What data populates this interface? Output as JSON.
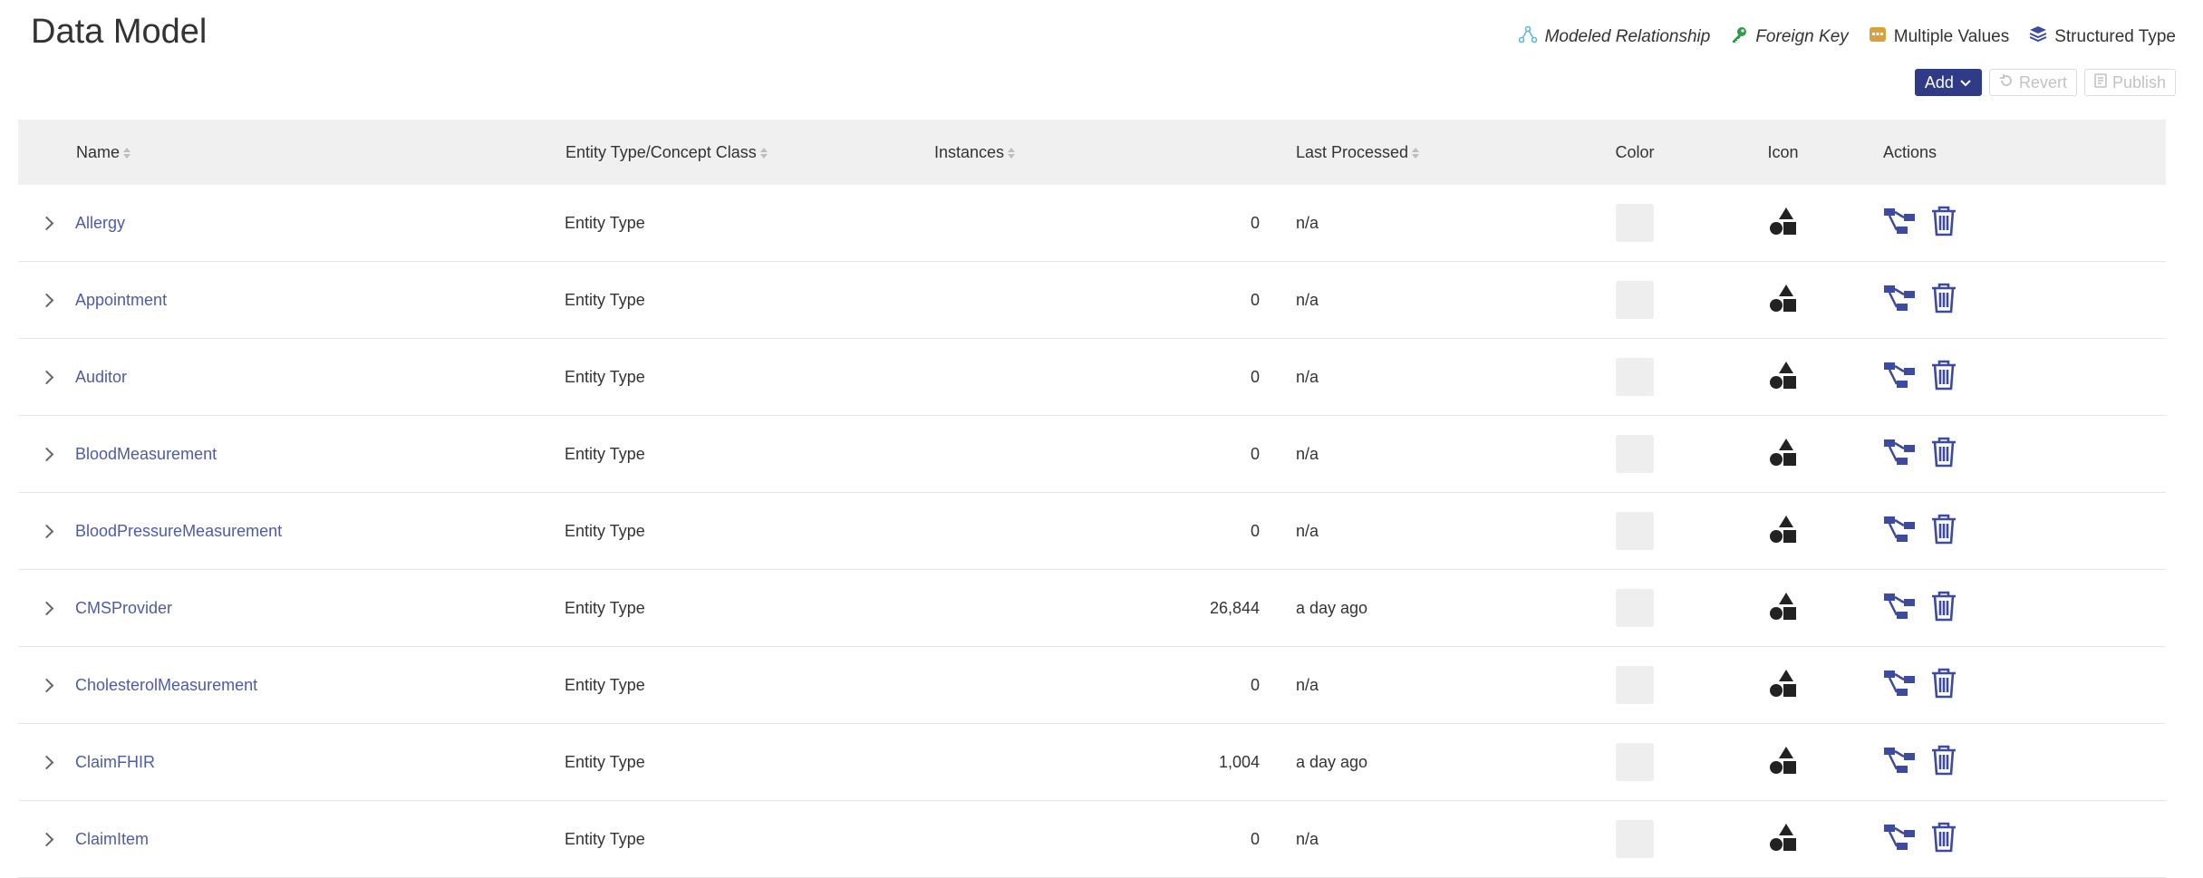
{
  "page": {
    "title": "Data Model"
  },
  "legend": [
    {
      "icon": "modeled-relationship-icon",
      "label": "Modeled Relationship",
      "italic": true,
      "color": "#5bb8d9"
    },
    {
      "icon": "key-icon",
      "label": "Foreign Key",
      "italic": true,
      "color": "#2e9c4c"
    },
    {
      "icon": "multiple-values-icon",
      "label": "Multiple Values",
      "italic": false,
      "color": "#d7a13b"
    },
    {
      "icon": "structured-type-icon",
      "label": "Structured Type",
      "italic": false,
      "color": "#3c4aa0"
    }
  ],
  "toolbar": {
    "add_label": "Add",
    "revert_label": "Revert",
    "publish_label": "Publish"
  },
  "table": {
    "headers": {
      "name": "Name",
      "type": "Entity Type/Concept Class",
      "instances": "Instances",
      "last_processed": "Last Processed",
      "color": "Color",
      "icon": "Icon",
      "actions": "Actions"
    },
    "rows": [
      {
        "name": "Allergy",
        "type": "Entity Type",
        "instances": "0",
        "last_processed": "n/a",
        "linked": false
      },
      {
        "name": "Appointment",
        "type": "Entity Type",
        "instances": "0",
        "last_processed": "n/a",
        "linked": false
      },
      {
        "name": "Auditor",
        "type": "Entity Type",
        "instances": "0",
        "last_processed": "n/a",
        "linked": false
      },
      {
        "name": "BloodMeasurement",
        "type": "Entity Type",
        "instances": "0",
        "last_processed": "n/a",
        "linked": false
      },
      {
        "name": "BloodPressureMeasurement",
        "type": "Entity Type",
        "instances": "0",
        "last_processed": "n/a",
        "linked": false
      },
      {
        "name": "CMSProvider",
        "type": "Entity Type",
        "instances": "26,844",
        "last_processed": "a day ago",
        "linked": true
      },
      {
        "name": "CholesterolMeasurement",
        "type": "Entity Type",
        "instances": "0",
        "last_processed": "n/a",
        "linked": false
      },
      {
        "name": "ClaimFHIR",
        "type": "Entity Type",
        "instances": "1,004",
        "last_processed": "a day ago",
        "linked": true
      },
      {
        "name": "ClaimItem",
        "type": "Entity Type",
        "instances": "0",
        "last_processed": "n/a",
        "linked": false
      }
    ]
  },
  "colors": {
    "accent": "#2f3b87",
    "link": "#4e5ba6",
    "header_bg": "#f0f0f0",
    "swatch": "#eeeeee"
  }
}
